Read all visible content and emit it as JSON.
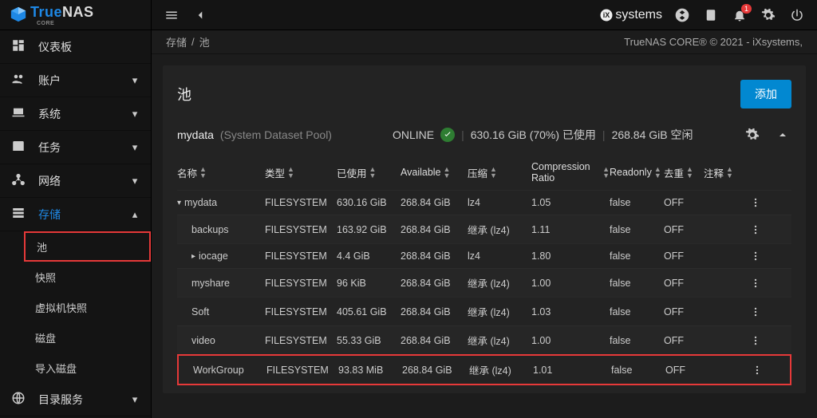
{
  "brand": {
    "true": "True",
    "nas": "NAS",
    "core": "CORE"
  },
  "copyright": "TrueNAS CORE® © 2021 - iXsystems,",
  "ix_brand": "systems",
  "bell_badge": "1",
  "breadcrumb": {
    "storage": "存储",
    "sep": "/",
    "pool": "池"
  },
  "sidebar": {
    "items": [
      {
        "label": "仪表板",
        "icon": "dashboard"
      },
      {
        "label": "账户",
        "icon": "people",
        "expandable": true
      },
      {
        "label": "系统",
        "icon": "laptop",
        "expandable": true
      },
      {
        "label": "任务",
        "icon": "calendar",
        "expandable": true
      },
      {
        "label": "网络",
        "icon": "network",
        "expandable": true
      },
      {
        "label": "存储",
        "icon": "storage",
        "expandable": true,
        "active": true,
        "expanded": true
      },
      {
        "label": "目录服务",
        "icon": "globe",
        "expandable": true
      }
    ],
    "storage_sub": [
      {
        "label": "池",
        "selected": true
      },
      {
        "label": "快照"
      },
      {
        "label": "虚拟机快照"
      },
      {
        "label": "磁盘"
      },
      {
        "label": "导入磁盘"
      }
    ]
  },
  "card": {
    "title": "池",
    "add_label": "添加"
  },
  "pool": {
    "name": "mydata",
    "subtitle": "(System Dataset Pool)",
    "status": "ONLINE",
    "used": "630.16 GiB (70%) 已使用",
    "free": "268.84 GiB 空闲"
  },
  "columns": {
    "name": "名称",
    "type": "类型",
    "used": "已使用",
    "available": "Available",
    "compression": "压缩",
    "ratio": "Compression Ratio",
    "readonly": "Readonly",
    "dedup": "去重",
    "comment": "注释"
  },
  "rows": [
    {
      "name": "mydata",
      "indent": 0,
      "chevron": "down",
      "type": "FILESYSTEM",
      "used": "630.16 GiB",
      "avail": "268.84 GiB",
      "comp": "lz4",
      "ratio": "1.05",
      "ro": "false",
      "dedup": "OFF"
    },
    {
      "name": "backups",
      "indent": 1,
      "type": "FILESYSTEM",
      "used": "163.92 GiB",
      "avail": "268.84 GiB",
      "comp": "继承 (lz4)",
      "ratio": "1.11",
      "ro": "false",
      "dedup": "OFF"
    },
    {
      "name": "iocage",
      "indent": 1,
      "chevron": "right",
      "type": "FILESYSTEM",
      "used": "4.4 GiB",
      "avail": "268.84 GiB",
      "comp": "lz4",
      "ratio": "1.80",
      "ro": "false",
      "dedup": "OFF"
    },
    {
      "name": "myshare",
      "indent": 1,
      "type": "FILESYSTEM",
      "used": "96 KiB",
      "avail": "268.84 GiB",
      "comp": "继承 (lz4)",
      "ratio": "1.00",
      "ro": "false",
      "dedup": "OFF"
    },
    {
      "name": "Soft",
      "indent": 1,
      "type": "FILESYSTEM",
      "used": "405.61 GiB",
      "avail": "268.84 GiB",
      "comp": "继承 (lz4)",
      "ratio": "1.03",
      "ro": "false",
      "dedup": "OFF"
    },
    {
      "name": "video",
      "indent": 1,
      "type": "FILESYSTEM",
      "used": "55.33 GiB",
      "avail": "268.84 GiB",
      "comp": "继承 (lz4)",
      "ratio": "1.00",
      "ro": "false",
      "dedup": "OFF"
    },
    {
      "name": "WorkGroup",
      "indent": 1,
      "highlight": true,
      "type": "FILESYSTEM",
      "used": "93.83 MiB",
      "avail": "268.84 GiB",
      "comp": "继承 (lz4)",
      "ratio": "1.01",
      "ro": "false",
      "dedup": "OFF"
    }
  ]
}
